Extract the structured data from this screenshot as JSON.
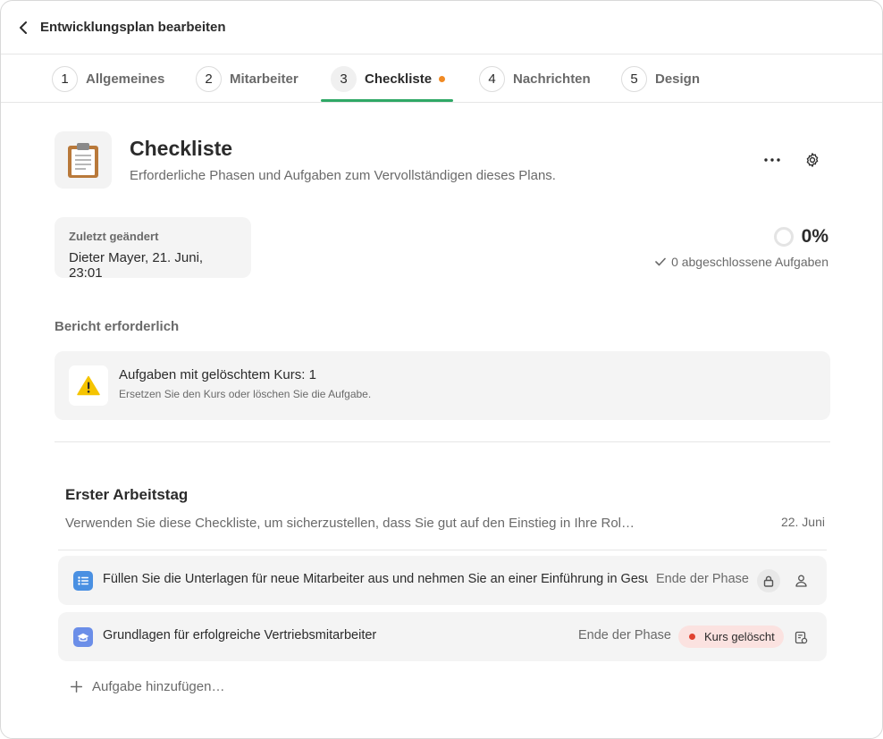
{
  "header": {
    "title": "Entwicklungsplan bearbeiten"
  },
  "tabs": [
    {
      "num": "1",
      "label": "Allgemeines"
    },
    {
      "num": "2",
      "label": "Mitarbeiter"
    },
    {
      "num": "3",
      "label": "Checkliste"
    },
    {
      "num": "4",
      "label": "Nachrichten"
    },
    {
      "num": "5",
      "label": "Design"
    }
  ],
  "page": {
    "title": "Checkliste",
    "subtitle": "Erforderliche Phasen und Aufgaben zum Vervollständigen dieses Plans."
  },
  "last_changed": {
    "label": "Zuletzt geändert",
    "value": "Dieter Mayer, 21. Juni, 23:01"
  },
  "progress": {
    "percent_label": "0%",
    "fraction": 0,
    "completed_label": "0 abgeschlossene Aufgaben"
  },
  "report": {
    "section_label": "Bericht erforderlich",
    "title": "Aufgaben mit gelöschtem Kurs: 1",
    "description": "Ersetzen Sie den Kurs oder löschen Sie die Aufgabe."
  },
  "phase": {
    "title": "Erster Arbeitstag",
    "description": "Verwenden Sie diese Checkliste, um sicherzustellen, dass Sie gut auf den Einstieg in Ihre Rol…",
    "date": "22. Juni",
    "tasks": [
      {
        "title": "Füllen Sie die Unterlagen für neue Mitarbeiter aus und nehmen Sie an einer Einführung in Gesun…",
        "due": "Ende der Phase"
      },
      {
        "title": "Grundlagen für erfolgreiche Vertriebsmitarbeiter",
        "due": "Ende der Phase",
        "badge": "Kurs gelöscht"
      }
    ],
    "add_task_label": "Aufgabe hinzufügen…"
  },
  "colors": {
    "accent_green": "#2fa866",
    "tab_dot_orange": "#f08a24",
    "task_icon_blue": "#4a90e2",
    "badge_bg": "#fbe2e0",
    "badge_dot_red": "#e0412f",
    "warning_yellow": "#f5c400"
  }
}
